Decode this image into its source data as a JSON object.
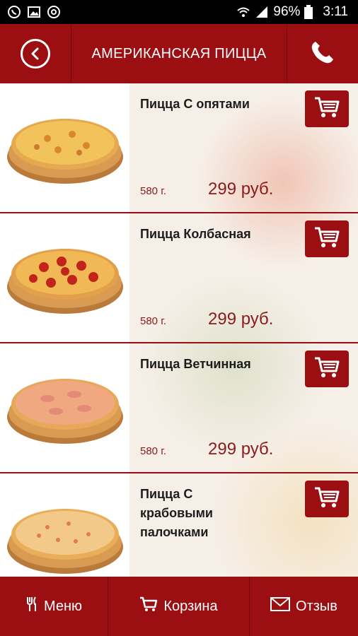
{
  "status_bar": {
    "left_icons": [
      "whatsapp-icon",
      "image-icon",
      "at-icon"
    ],
    "battery": "96%",
    "time": "3:11"
  },
  "header": {
    "title": "АМЕРИКАНСКАЯ ПИЦЦА",
    "back_icon": "back-arrow-icon",
    "phone_icon": "phone-icon"
  },
  "products": [
    {
      "name": "Пицца С опятами",
      "weight": "580 г.",
      "price": "299 руб."
    },
    {
      "name": "Пицца Колбасная",
      "weight": "580 г.",
      "price": "299 руб."
    },
    {
      "name": "Пицца Ветчинная",
      "weight": "580 г.",
      "price": "299 руб."
    },
    {
      "name": "Пицца С крабовыми палочками",
      "weight": "",
      "price": ""
    }
  ],
  "bottom_nav": {
    "menu": "Меню",
    "cart": "Корзина",
    "review": "Отзыв"
  },
  "colors": {
    "brand": "#9b0e12",
    "price": "#8a1c1c"
  }
}
